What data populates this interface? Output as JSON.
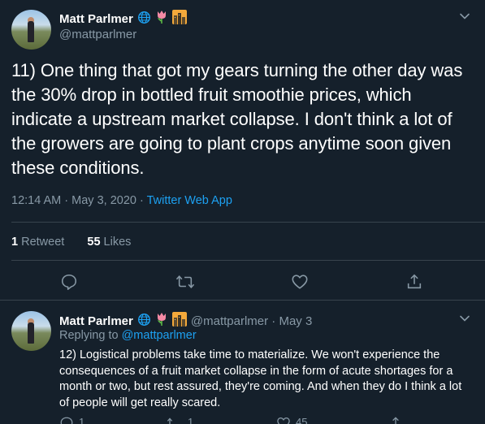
{
  "colors": {
    "background": "#15202b",
    "text": "#ffffff",
    "muted": "#8899a6",
    "accent": "#1da1f2",
    "divider": "#38444d"
  },
  "main_tweet": {
    "author_name": "Matt Parlmer",
    "author_handle": "@mattparlmer",
    "badges": [
      "globe-icon",
      "tulip-icon",
      "city-dusk-icon"
    ],
    "text": "11) One thing that got my gears turning the other day was the 30% drop in bottled fruit smoothie prices, which indicate a upstream market collapse. I don't think a lot of the growers are going to plant crops anytime soon given these conditions.",
    "time": "12:14 AM · May 3, 2020 · ",
    "source": "Twitter Web App",
    "retweets_count": "1",
    "retweets_label": " Retweet",
    "likes_count": "55",
    "likes_label": " Likes"
  },
  "reply_tweet": {
    "author_name": "Matt Parlmer",
    "author_handle_date": "@mattparlmer · May 3",
    "replying_prefix": "Replying to ",
    "replying_to": "@mattparlmer",
    "text": "12) Logistical problems take time to materialize. We won't experience the consequences of a fruit market collapse in the form of acute shortages for a month or two, but rest assured, they're coming. And when they do I think a lot of people will get really scared.",
    "reply_count": "1",
    "retweet_count": "1",
    "like_count": "45"
  }
}
